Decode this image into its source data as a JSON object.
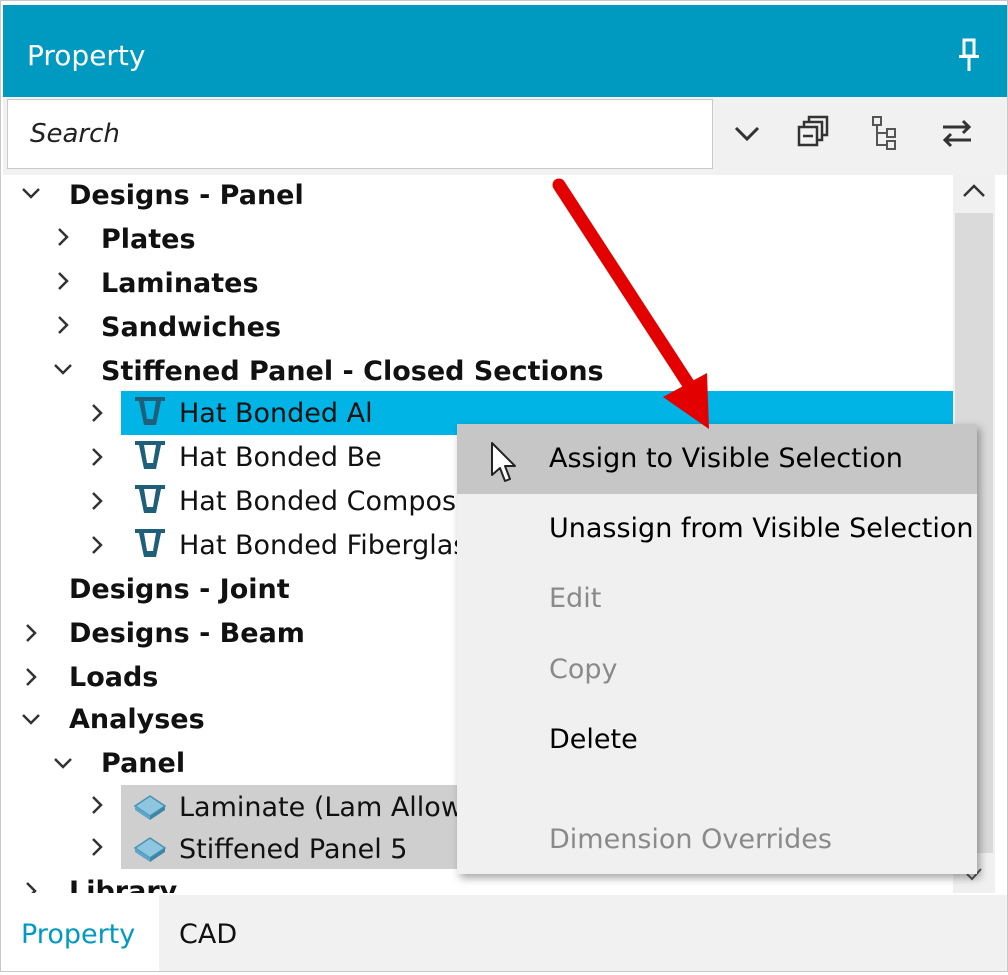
{
  "panel": {
    "title": "Property"
  },
  "search": {
    "placeholder": "Search"
  },
  "tree": {
    "designs_panel": "Designs - Panel",
    "plates": "Plates",
    "laminates": "Laminates",
    "sandwiches": "Sandwiches",
    "stiffened_closed": "Stiffened Panel - Closed Sections",
    "hat_al": "Hat Bonded Al",
    "hat_be": "Hat Bonded Be",
    "hat_compos": "Hat Bonded Compos",
    "hat_fiberglass": "Hat Bonded Fiberglas",
    "designs_joint": "Designs - Joint",
    "designs_beam": "Designs - Beam",
    "loads": "Loads",
    "analyses": "Analyses",
    "panel": "Panel",
    "laminate_lam": "Laminate (Lam Allowa",
    "stiffened5": "Stiffened Panel 5",
    "library": "Library"
  },
  "context_menu": {
    "assign": "Assign to Visible Selection",
    "unassign": "Unassign from Visible Selection",
    "edit": "Edit",
    "copy": "Copy",
    "delete": "Delete",
    "dimension_overrides": "Dimension Overrides"
  },
  "tabs": {
    "property": "Property",
    "cad": "CAD"
  },
  "colors": {
    "header": "#0099c0",
    "selected_row": "#00b4e6",
    "arrow": "#e30000"
  }
}
